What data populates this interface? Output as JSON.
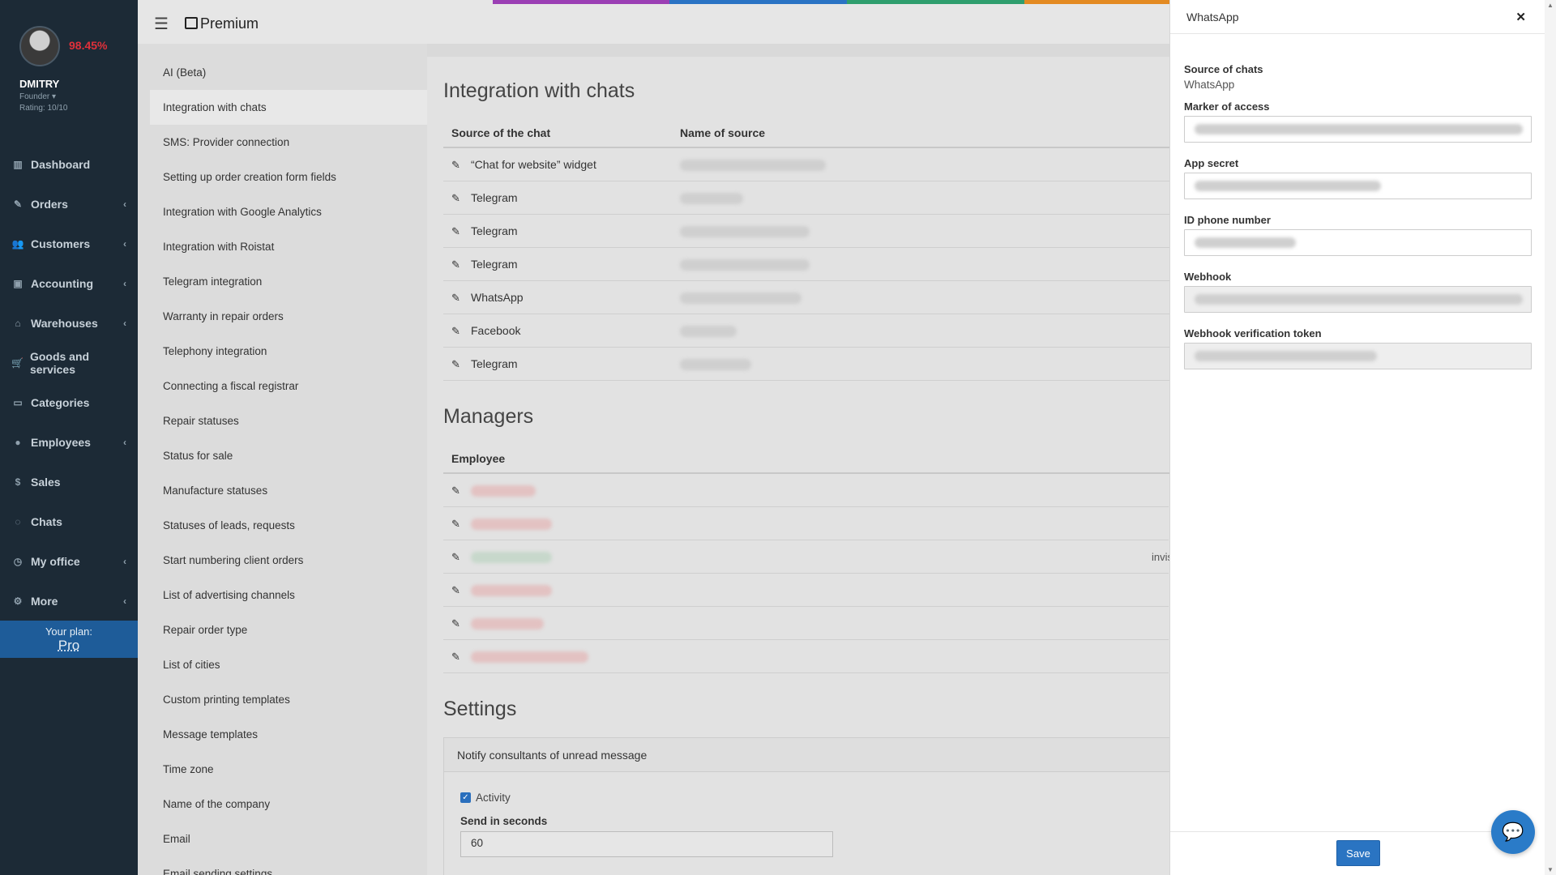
{
  "profile": {
    "name": "DMITRY",
    "percent": "98.45%",
    "role": "Founder",
    "rating": "Rating: 10/10"
  },
  "nav": [
    {
      "label": "Dashboard",
      "icon": "chart-icon",
      "glyph": "▥",
      "chevron": false
    },
    {
      "label": "Orders",
      "icon": "edit-icon",
      "glyph": "✎",
      "chevron": true
    },
    {
      "label": "Customers",
      "icon": "users-icon",
      "glyph": "👥",
      "chevron": true
    },
    {
      "label": "Accounting",
      "icon": "money-icon",
      "glyph": "▣",
      "chevron": true
    },
    {
      "label": "Warehouses",
      "icon": "inbox-icon",
      "glyph": "⌂",
      "chevron": true
    },
    {
      "label": "Goods and services",
      "icon": "cart-icon",
      "glyph": "🛒",
      "chevron": false
    },
    {
      "label": "Categories",
      "icon": "folder-icon",
      "glyph": "▭",
      "chevron": false
    },
    {
      "label": "Employees",
      "icon": "user-icon",
      "glyph": "●",
      "chevron": true
    },
    {
      "label": "Sales",
      "icon": "dollar-icon",
      "glyph": "$",
      "chevron": false
    },
    {
      "label": "Chats",
      "icon": "chat-icon",
      "glyph": "◌",
      "chevron": false
    },
    {
      "label": "My office",
      "icon": "clock-icon",
      "glyph": "◷",
      "chevron": true
    },
    {
      "label": "More",
      "icon": "gear-icon",
      "glyph": "⚙",
      "chevron": true
    }
  ],
  "plan": {
    "label": "Your plan:",
    "value": "Pro"
  },
  "brand": "Premium",
  "stripe_colors": [
    "#e6e6e6",
    "#e6e6e6",
    "#9b3fb4",
    "#2a73c4",
    "#2f9e6e",
    "#e38a22",
    "#e5762a",
    "#e6e6e6"
  ],
  "settings_menu": [
    "AI (Beta)",
    "Integration with chats",
    "SMS: Provider connection",
    "Setting up order creation form fields",
    "Integration with Google Analytics",
    "Integration with Roistat",
    "Telegram integration",
    "Warranty in repair orders",
    "Telephony integration",
    "Connecting a fiscal registrar",
    "Repair statuses",
    "Status for sale",
    "Manufacture statuses",
    "Statuses of leads, requests",
    "Start numbering client orders",
    "List of advertising channels",
    "Repair order type",
    "List of cities",
    "Custom printing templates",
    "Message templates",
    "Time zone",
    "Name of the company",
    "Email",
    "Email sending settings"
  ],
  "active_setting_index": 1,
  "integration": {
    "title": "Integration with chats",
    "col_source": "Source of the chat",
    "col_name": "Name of source",
    "rows": [
      "“Chat for website” widget",
      "Telegram",
      "Telegram",
      "Telegram",
      "WhatsApp",
      "Facebook",
      "Telegram"
    ]
  },
  "managers": {
    "title": "Managers",
    "col_employee": "Employee",
    "invis_label": "invis",
    "count": 6
  },
  "settings": {
    "title": "Settings",
    "panel_title": "Notify consultants of unread message",
    "activity_label": "Activity",
    "send_label": "Send in seconds",
    "send_value": "60"
  },
  "drawer": {
    "title": "WhatsApp",
    "source_label": "Source of chats",
    "source_value": "WhatsApp",
    "fields": [
      {
        "label": "Marker of access",
        "readonly": false
      },
      {
        "label": "App secret",
        "readonly": false
      },
      {
        "label": "ID phone number",
        "readonly": false
      },
      {
        "label": "Webhook",
        "readonly": true
      },
      {
        "label": "Webhook verification token",
        "readonly": true
      }
    ],
    "save_label": "Save"
  }
}
